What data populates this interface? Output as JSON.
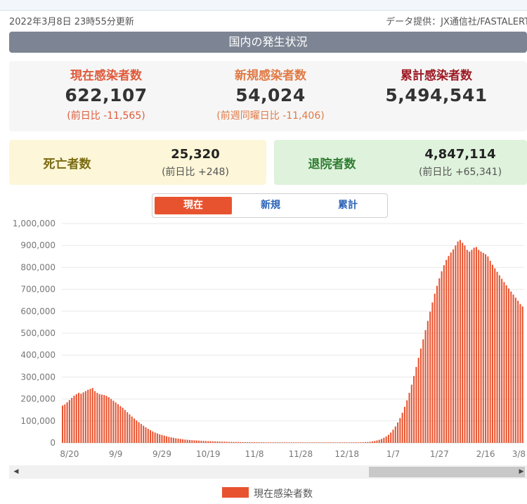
{
  "header": {
    "updated": "2022年3月8日 23時55分更新",
    "source": "データ提供：JX通信社/FASTALERT"
  },
  "section_title": "国内の発生状況",
  "stats": [
    {
      "label": "現在感染者数",
      "value": "622,107",
      "sub": "(前日比 -11,565)"
    },
    {
      "label": "新規感染者数",
      "value": "54,024",
      "sub": "(前週同曜日比 -11,406)"
    },
    {
      "label": "累計感染者数",
      "value": "5,494,541"
    }
  ],
  "deaths": {
    "label": "死亡者数",
    "value": "25,320",
    "sub": "(前日比 +248)"
  },
  "recovered": {
    "label": "退院者数",
    "value": "4,847,114",
    "sub": "(前日比 +65,341)"
  },
  "tabs": [
    {
      "label": "現在",
      "active": true
    },
    {
      "label": "新規",
      "active": false
    },
    {
      "label": "累計",
      "active": false
    }
  ],
  "colors": {
    "bar": "#e8532f",
    "active_tab": "#e8532f",
    "tab_text": "#2a62b8"
  },
  "scrollbar": {
    "left_icon": "arrow-left-icon",
    "right_icon": "arrow-right-icon"
  },
  "chart_data": {
    "type": "bar",
    "ylim": [
      0,
      1000000
    ],
    "yticks": [
      0,
      100000,
      200000,
      300000,
      400000,
      500000,
      600000,
      700000,
      800000,
      900000,
      1000000
    ],
    "ytick_labels": [
      "0",
      "100,000",
      "200,000",
      "300,000",
      "400,000",
      "500,000",
      "600,000",
      "700,000",
      "800,000",
      "900,000",
      "1,000,000"
    ],
    "xtick_labels": [
      "8/20",
      "9/9",
      "9/29",
      "10/19",
      "11/8",
      "11/28",
      "12/18",
      "1/7",
      "1/27",
      "2/16",
      "3/8"
    ],
    "grid": true,
    "legend": {
      "position": "bottom",
      "label": "現在感染者数"
    },
    "series": [
      {
        "name": "現在感染者数",
        "start_date": "2021-08-17",
        "values": [
          170000,
          175000,
          185000,
          195000,
          205000,
          215000,
          222000,
          228000,
          224000,
          230000,
          236000,
          242000,
          246000,
          250000,
          236000,
          228000,
          222000,
          220000,
          218000,
          214000,
          208000,
          200000,
          192000,
          184000,
          176000,
          168000,
          160000,
          150000,
          140000,
          130000,
          120000,
          111000,
          102000,
          94000,
          86000,
          78000,
          71000,
          64000,
          58000,
          52000,
          47000,
          43000,
          39000,
          36000,
          33000,
          30000,
          27000,
          25000,
          23000,
          21000,
          19500,
          18000,
          16500,
          15000,
          14000,
          13000,
          12000,
          11300,
          10600,
          10000,
          9400,
          8900,
          8400,
          7900,
          7400,
          7000,
          6600,
          6200,
          5800,
          5500,
          5200,
          4900,
          4600,
          4400,
          4200,
          4000,
          3800,
          3600,
          3400,
          3300,
          3200,
          3100,
          3000,
          2900,
          2800,
          2700,
          2650,
          2600,
          2550,
          2500,
          2450,
          2400,
          2380,
          2360,
          2340,
          2320,
          2300,
          2290,
          2280,
          2270,
          2260,
          2250,
          2240,
          2230,
          2220,
          2210,
          2200,
          2200,
          2200,
          2200,
          2200,
          2200,
          2200,
          2200,
          2200,
          2200,
          2200,
          2200,
          2200,
          2200,
          2210,
          2220,
          2240,
          2260,
          2280,
          2300,
          2350,
          2400,
          2500,
          2700,
          3000,
          3400,
          4000,
          5000,
          6500,
          8500,
          11000,
          14000,
          18000,
          23000,
          29000,
          37000,
          47000,
          60000,
          75000,
          93000,
          113000,
          137000,
          164000,
          194000,
          228000,
          265000,
          305000,
          346000,
          388000,
          430000,
          472000,
          514000,
          556000,
          598000,
          640000,
          680000,
          716000,
          750000,
          782000,
          810000,
          834000,
          852000,
          868000,
          882000,
          900000,
          918000,
          925000,
          912000,
          900000,
          880000,
          872000,
          880000,
          890000,
          893000,
          880000,
          872000,
          866000,
          860000,
          850000,
          830000,
          812000,
          796000,
          780000,
          764000,
          748000,
          733000,
          718000,
          704000,
          690000,
          676000,
          662000,
          648000,
          633000,
          622107
        ]
      }
    ]
  }
}
